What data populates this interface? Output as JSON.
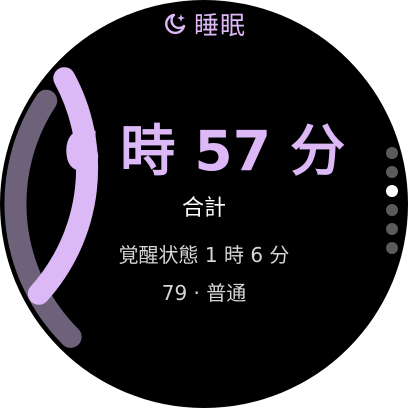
{
  "header": {
    "title": "睡眠",
    "icon": "sleep-moon-icon"
  },
  "sleep": {
    "duration": "6 時 57 分",
    "duration_label": "合計",
    "awake": "覚醒状態 1 時 6 分",
    "score": "79 · 普通",
    "progress_fraction": 0.86
  },
  "pagination": {
    "total": 6,
    "active_index": 2
  },
  "colors": {
    "accent": "#dcb8f6",
    "arc_dim": "#6e617a",
    "background": "#000000",
    "text_primary": "#ffffff",
    "text_secondary": "#d6d6d6",
    "dot_inactive": "#5b5b5b",
    "dot_active": "#ffffff"
  }
}
